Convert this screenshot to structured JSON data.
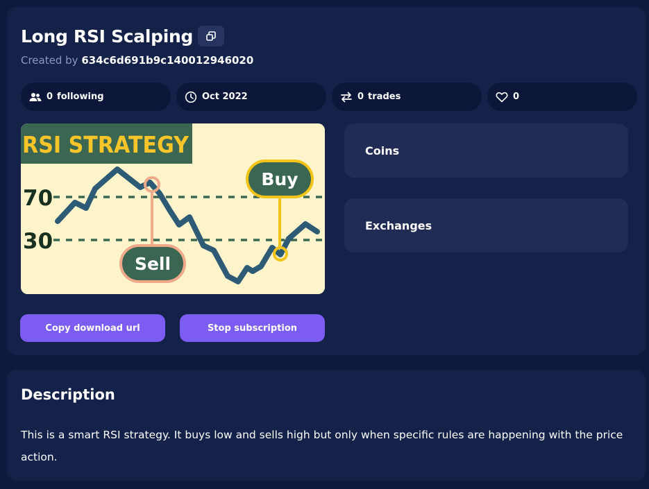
{
  "header": {
    "title": "Long RSI Scalping",
    "created_by_label": "Created by",
    "creator_id": "634c6d691b9c140012946020",
    "copy_icon": "copy-icon"
  },
  "stats": {
    "following_count": "0",
    "following_label": "following",
    "following_icon": "users-icon",
    "date": "Oct 2022",
    "date_icon": "clock-icon",
    "trades_count": "0",
    "trades_label": "trades",
    "trades_icon": "arrows-exchange-icon",
    "likes_count": "0",
    "likes_icon": "heart-icon"
  },
  "image": {
    "banner": "RSI STRATEGY",
    "level_high": "70",
    "level_low": "30",
    "buy_label": "Buy",
    "sell_label": "Sell"
  },
  "info": {
    "coins_label": "Coins",
    "exchanges_label": "Exchanges"
  },
  "actions": {
    "copy_url_label": "Copy download url",
    "stop_subscription_label": "Stop subscription"
  },
  "description": {
    "title": "Description",
    "text": "This is a smart RSI strategy. It buys low and sells high but only when specific rules are happening with the price action."
  },
  "colors": {
    "background": "#0e1a3d",
    "card": "#142149",
    "pill": "#0c1638",
    "info_box": "#212c55",
    "accent_button": "#7d5cf3",
    "image_bg": "#fdf4cc",
    "image_line": "#2d5a74",
    "image_green": "#3a6652",
    "banner_text": "#f7c52a",
    "sell_outline": "#efa98b",
    "buy_outline": "#f2c318"
  }
}
